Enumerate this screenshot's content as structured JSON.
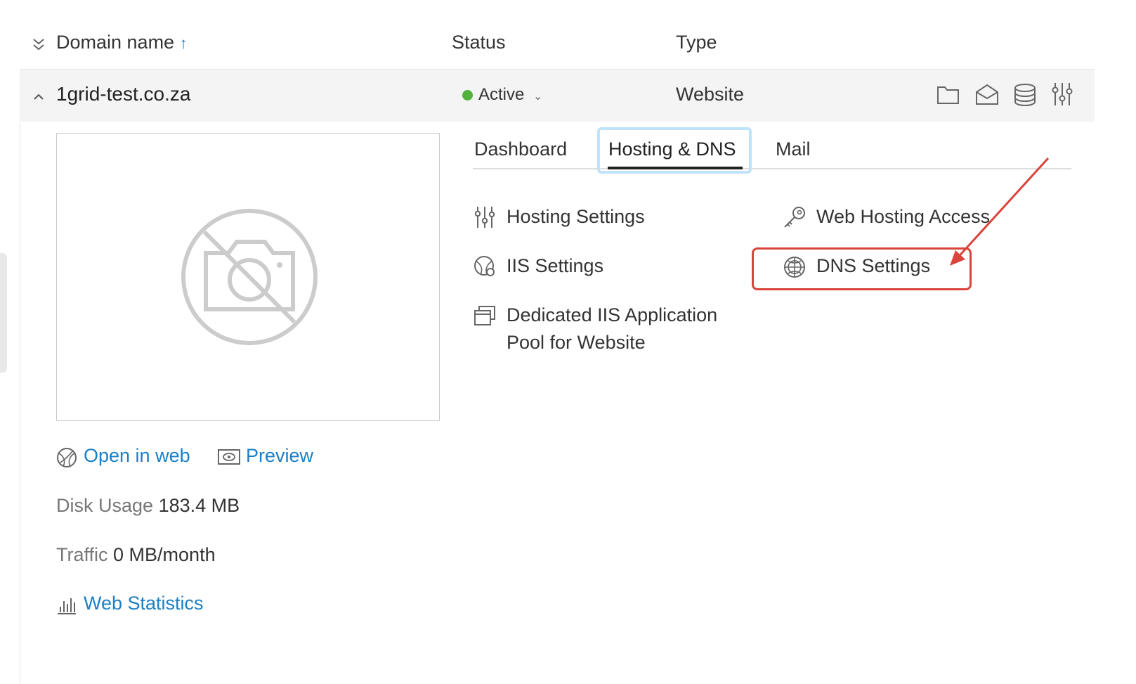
{
  "columns": {
    "domain_name": "Domain name",
    "status": "Status",
    "type": "Type"
  },
  "row": {
    "domain": "1grid-test.co.za",
    "status": "Active",
    "status_color": "#52b23c",
    "type": "Website"
  },
  "tabs": [
    {
      "label": "Dashboard"
    },
    {
      "label": "Hosting & DNS",
      "active": true
    },
    {
      "label": "Mail"
    }
  ],
  "hosting_links": {
    "hosting_settings": "Hosting Settings",
    "iis_settings": "IIS Settings",
    "dedicated_pool_line1": "Dedicated IIS Application",
    "dedicated_pool_line2": "Pool for Website",
    "web_hosting_access": "Web Hosting Access",
    "dns_settings": "DNS Settings"
  },
  "left_panel": {
    "open_in_web": "Open in web",
    "preview": "Preview",
    "disk_usage_label": "Disk Usage",
    "disk_usage_value": "183.4 MB",
    "traffic_label": "Traffic",
    "traffic_value": "0 MB/month",
    "web_statistics": "Web Statistics"
  },
  "colors": {
    "link_blue": "#1b7fc6",
    "annotation_red": "#d9443c",
    "tab_focus": "#bfe3fb"
  }
}
